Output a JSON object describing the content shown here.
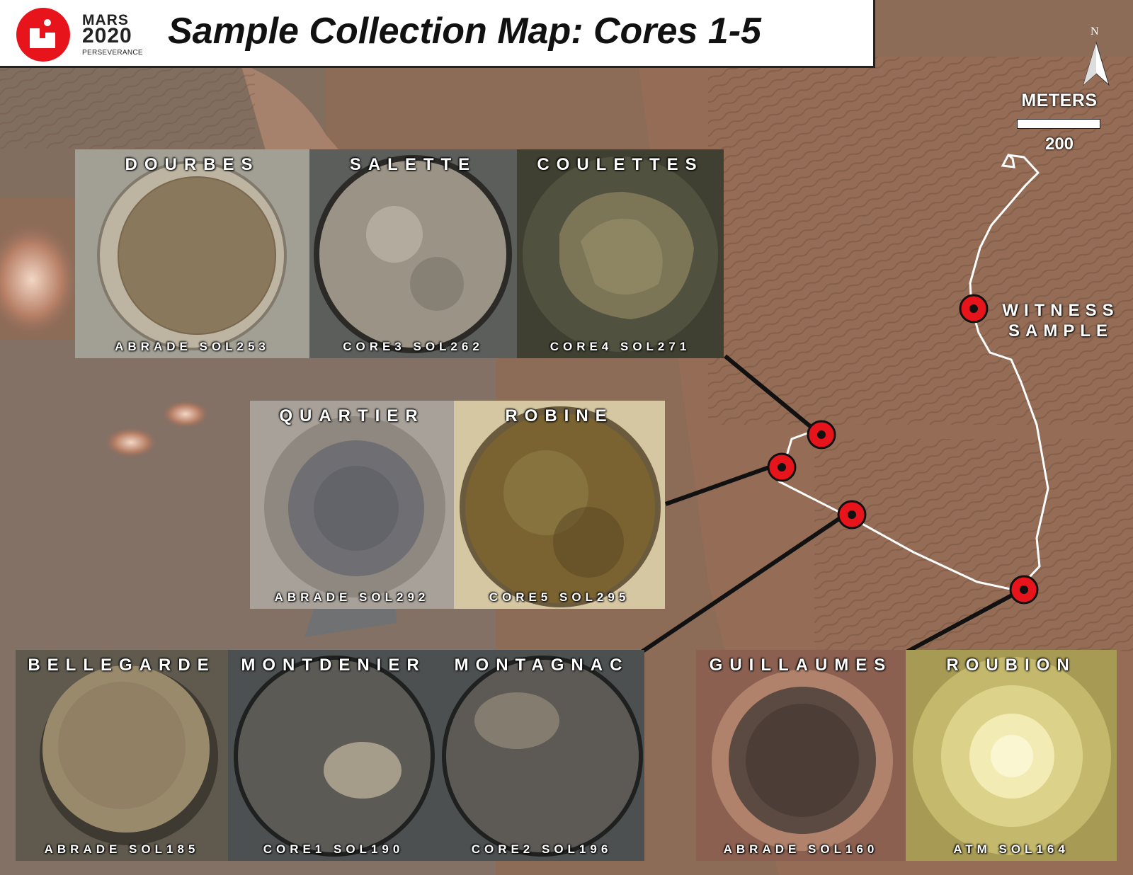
{
  "header": {
    "logo_line1": "MARS",
    "logo_line2": "2020",
    "logo_line3": "PERSEVERANCE",
    "title": "Sample Collection Map: Cores 1-5"
  },
  "compass": {
    "north_label": "N",
    "icon": "north-arrow-icon"
  },
  "scale": {
    "unit_label": "METERS",
    "value": "200"
  },
  "witness": {
    "label": "WITNESS SAMPLE"
  },
  "colors": {
    "marker_red": "#e8141c",
    "route_white": "#ffffff",
    "connector_black": "#111111"
  },
  "samples": [
    {
      "id": "dourbes",
      "name": "DOURBES",
      "caption": "ABRADE SOL253"
    },
    {
      "id": "salette",
      "name": "SALETTE",
      "caption": "CORE3 SOL262"
    },
    {
      "id": "coulettes",
      "name": "COULETTES",
      "caption": "CORE4 SOL271"
    },
    {
      "id": "quartier",
      "name": "QUARTIER",
      "caption": "ABRADE SOL292"
    },
    {
      "id": "robine",
      "name": "ROBINE",
      "caption": "CORE5 SOL295"
    },
    {
      "id": "bellegarde",
      "name": "BELLEGARDE",
      "caption": "ABRADE SOL185"
    },
    {
      "id": "montdenier",
      "name": "MONTDENIER",
      "caption": "CORE1 SOL190"
    },
    {
      "id": "montagnac",
      "name": "MONTAGNAC",
      "caption": "CORE2 SOL196"
    },
    {
      "id": "guillaumes",
      "name": "GUILLAUMES",
      "caption": "ABRADE SOL160"
    },
    {
      "id": "roubion",
      "name": "ROUBION",
      "caption": "ATM SOL164"
    }
  ]
}
